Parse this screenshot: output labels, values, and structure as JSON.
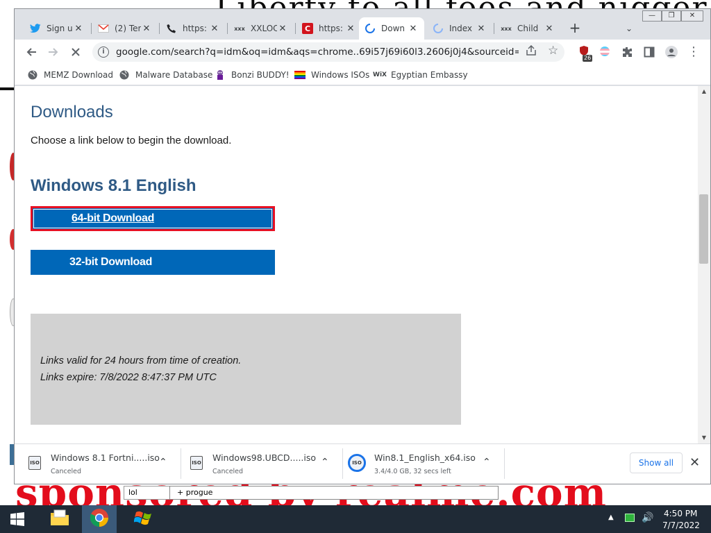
{
  "window": {
    "controls": {
      "minimize": "—",
      "restore": "❐",
      "close": "✕"
    }
  },
  "tabs": [
    {
      "title": "Sign u",
      "icon": "twitter-icon",
      "icon_color": "#1d9bf0"
    },
    {
      "title": "(2) Ter",
      "icon": "gmail-icon",
      "icon_color": "#ea4335"
    },
    {
      "title": "https:",
      "icon": "phone-icon",
      "icon_color": "#202124"
    },
    {
      "title": "XXLOC",
      "icon": "xxx-icon",
      "icon_color": "#202124"
    },
    {
      "title": "https:",
      "icon": "c-logo-icon",
      "icon_color": "#d2141d"
    },
    {
      "title": "Down",
      "icon": "loading-spinner-icon",
      "icon_color": "#1a73e8",
      "active": true
    },
    {
      "title": "Index",
      "icon": "loading-spinner-icon",
      "icon_color": "#8ab4f8"
    },
    {
      "title": "Child",
      "icon": "xxx-icon",
      "icon_color": "#202124"
    }
  ],
  "toolbar": {
    "url": "google.com/search?q=idm&oq=idm&aqs=chrome..69i57j69i60l3.2606j0j4&sourceid=chrome&ie=UTF-8",
    "extension_badge": "26"
  },
  "bookmarks": [
    {
      "label": "MEMZ Download",
      "icon": "globe-icon"
    },
    {
      "label": "Malware Database",
      "icon": "globe-icon"
    },
    {
      "label": "Bonzi BUDDY!",
      "icon": "bonzi-icon"
    },
    {
      "label": "Windows ISOs",
      "icon": "rainbow-flag-icon"
    },
    {
      "label": "Egyptian Embassy",
      "icon": "wix-icon"
    }
  ],
  "page": {
    "heading": "Downloads",
    "intro": "Choose a link below to begin the download.",
    "subheading": "Windows 8.1 English",
    "btn64_label": "64-bit Download",
    "btn32_label": "32-bit Download",
    "info_line1": "Links valid for 24 hours from time of creation.",
    "info_line2": "Links expire: 7/8/2022 8:47:37 PM UTC"
  },
  "downloads": {
    "items": [
      {
        "name": "Windows 8.1 Fortni.....iso",
        "status": "Canceled",
        "in_progress": false
      },
      {
        "name": "Windows98.UBCD.....iso",
        "status": "Canceled",
        "in_progress": false
      },
      {
        "name": "Win8.1_English_x64.iso",
        "status": "3.4/4.0 GB, 32 secs left",
        "in_progress": true,
        "progress": 0.85
      }
    ],
    "show_all_label": "Show all"
  },
  "desktop": {
    "scrawl_top": "Liberty to all foes and nigger",
    "scrawl_bottom": "sponsored by realme.com",
    "note_left": "lol",
    "note_right": "+ progue"
  },
  "taskbar": {
    "time": "4:50 PM",
    "date": "7/7/2022",
    "accent": "#1f2a36"
  },
  "colors": {
    "heading_blue": "#2f5a85",
    "button_blue": "#0067b8",
    "highlight_red": "#e81123",
    "info_gray": "#d2d2d2"
  }
}
